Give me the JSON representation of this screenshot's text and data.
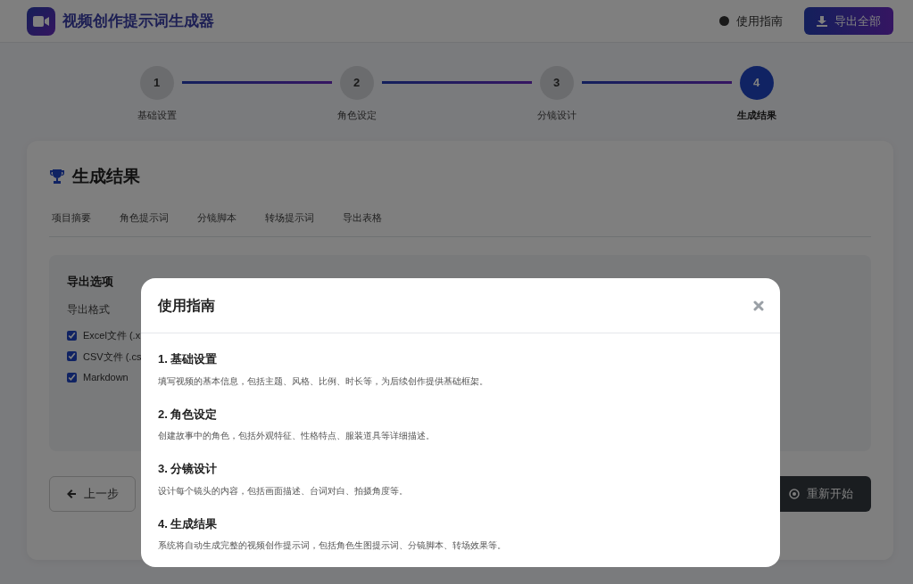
{
  "app": {
    "title": "视频创作提示词生成器",
    "guide_link": "使用指南",
    "export_all": "导出全部"
  },
  "steps": [
    {
      "number": "1",
      "label": "基础设置",
      "active": false
    },
    {
      "number": "2",
      "label": "角色设定",
      "active": false
    },
    {
      "number": "3",
      "label": "分镜设计",
      "active": false
    },
    {
      "number": "4",
      "label": "生成结果",
      "active": true
    }
  ],
  "card": {
    "title": "生成结果",
    "tabs": [
      "项目摘要",
      "角色提示词",
      "分镜脚本",
      "转场提示词",
      "导出表格"
    ],
    "export_options": {
      "heading": "导出选项",
      "format_label": "导出格式",
      "formats": [
        {
          "label": "Excel文件 (.x",
          "checked": true
        },
        {
          "label": "CSV文件 (.cs",
          "checked": true
        },
        {
          "label": "Markdown",
          "checked": true
        }
      ]
    },
    "prev_button": "上一步",
    "restart_button": "重新开始"
  },
  "modal": {
    "title": "使用指南",
    "sections": [
      {
        "heading": "1. 基础设置",
        "text": "填写视频的基本信息，包括主题、风格、比例、时长等，为后续创作提供基础框架。"
      },
      {
        "heading": "2. 角色设定",
        "text": "创建故事中的角色，包括外观特征、性格特点、服装道具等详细描述。"
      },
      {
        "heading": "3. 分镜设计",
        "text": "设计每个镜头的内容，包括画面描述、台词对白、拍摄角度等。"
      },
      {
        "heading": "4. 生成结果",
        "text": "系统将自动生成完整的视频创作提示词，包括角色生图提示词、分镜脚本、转场效果等。"
      }
    ]
  }
}
